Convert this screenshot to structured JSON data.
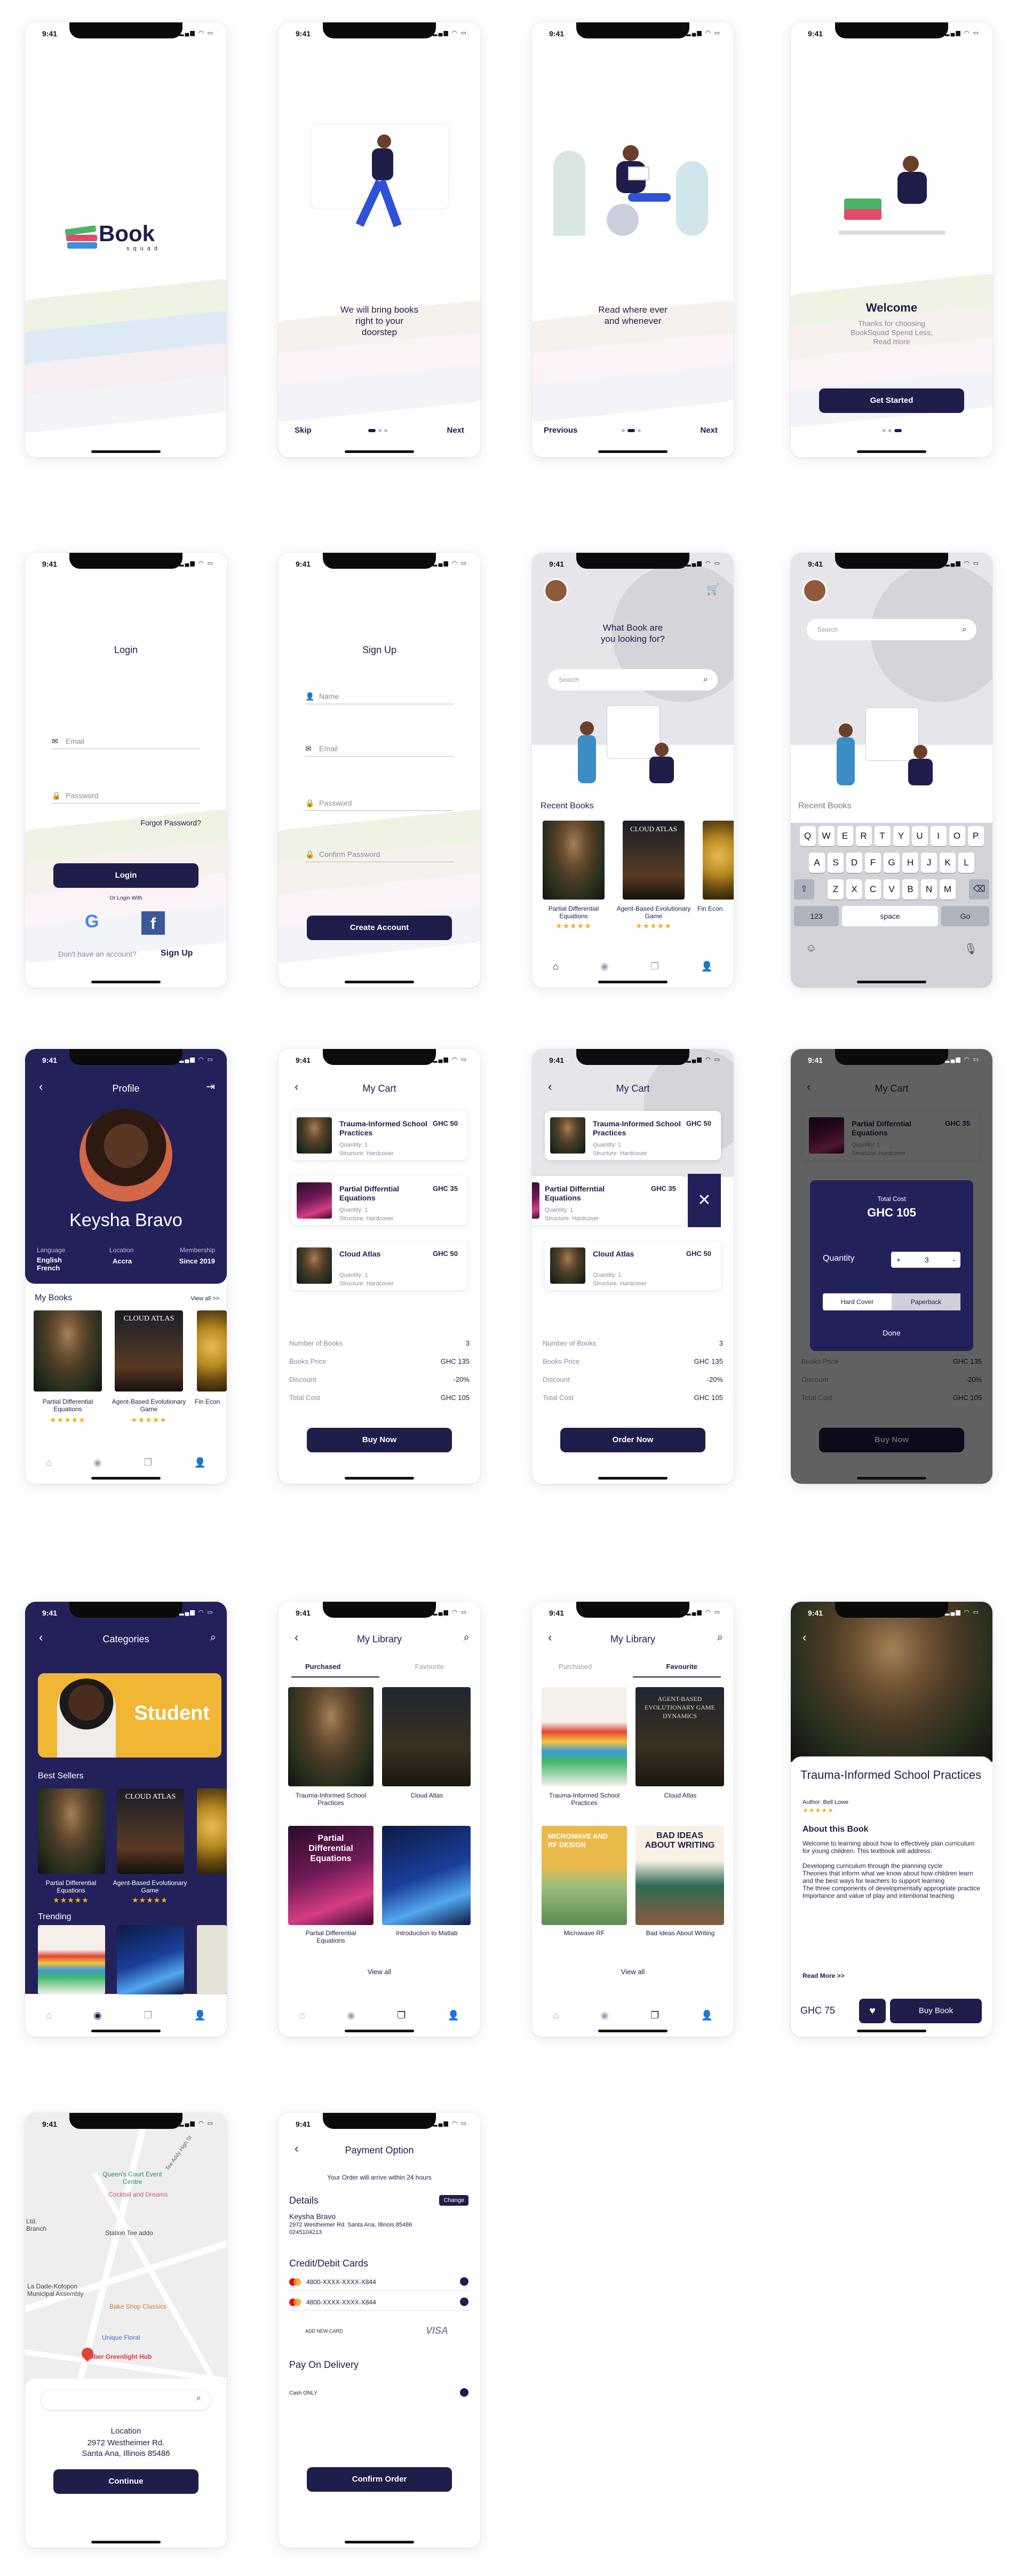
{
  "status_time": "9:41",
  "splash": {
    "logo_text": "Book",
    "logo_sub": "squad"
  },
  "onboard1": {
    "caption": "We will bring books right to your doorstep",
    "skip": "Skip",
    "next": "Next"
  },
  "onboard2": {
    "caption": "Read where ever and whenever",
    "previous": "Previous",
    "next": "Next"
  },
  "onboard3": {
    "title": "Welcome",
    "subtitle": "Thanks for choosing BookSquad Spend Less, Read more",
    "button": "Get Started"
  },
  "login": {
    "title": "Login",
    "email": "Email",
    "password": "Password",
    "forgot": "Forgot Password?",
    "button": "Login",
    "or": "Or Login With",
    "no_account": "Don't have an account?",
    "signup": "Sign Up"
  },
  "signup": {
    "title": "Sign Up",
    "name": "Name",
    "email": "Email",
    "password": "Password",
    "confirm": "Confirm Password",
    "button": "Create Account"
  },
  "home": {
    "question": "What Book are you looking for?",
    "search": "Search",
    "recent": "Recent Books"
  },
  "keyboard": {
    "search": "Search",
    "recent": "Recent Books",
    "row1": [
      "Q",
      "W",
      "E",
      "R",
      "T",
      "Y",
      "U",
      "I",
      "O",
      "P"
    ],
    "row2": [
      "A",
      "S",
      "D",
      "F",
      "G",
      "H",
      "J",
      "K",
      "L"
    ],
    "row3": [
      "Z",
      "X",
      "C",
      "V",
      "B",
      "N",
      "M"
    ],
    "num": "123",
    "space": "space",
    "go": "Go"
  },
  "books": {
    "partial": "Partial Differential Equations",
    "agent": "Agent-Based Evolutionary Game",
    "fin": "Fin Econ",
    "cloud_title": "CLOUD ATLAS",
    "trauma": "Trauma-Informed School Practices",
    "cloud": "Cloud Atlas",
    "intro": "Introduction to Matlab",
    "micro": "Microwave RF",
    "bad": "Bad Ideas About Writing",
    "partial_cover": "Partial Differential Equations",
    "agent_cover": "AGENT-BASED EVOLUTIONARY GAME DYNAMICS",
    "micro_cover": "MICROWAVE AND RF DESIGN",
    "bad_cover": "BAD IDEAS ABOUT WRITING",
    "stars": "★★★★★"
  },
  "profile": {
    "title": "Profile",
    "name": "Keysha Bravo",
    "lang_label": "Language",
    "lang": "English French",
    "loc_label": "Location",
    "loc": "Accra",
    "mem_label": "Membership",
    "mem": "Since 2019",
    "my_books": "My Books",
    "view_all": "View all >>"
  },
  "cart": {
    "title": "My Cart",
    "items": [
      {
        "title": "Trauma-Informed School Practices",
        "price": "GHC 50",
        "qty": "Quantity: 1",
        "struct": "Structure: Hardcover"
      },
      {
        "title": "Partial Differntial Equations",
        "price": "GHC 35",
        "qty": "Quantity: 1",
        "struct": "Structure: Hardcover"
      },
      {
        "title": "Cloud Atlas",
        "price": "GHC 50",
        "qty": "Quantity: 1",
        "struct": "Structure: Hardcover"
      }
    ],
    "num_label": "Number of Books",
    "num": "3",
    "price_label": "Books Price",
    "price": "GHC 135",
    "disc_label": "Discount",
    "disc": "-20%",
    "total_label": "Total Cost",
    "total": "GHC 105",
    "buy": "Buy Now",
    "order": "Order Now"
  },
  "modal": {
    "total_label": "Total Cost",
    "total": "GHC 105",
    "qty_label": "Quantity",
    "qty": "3",
    "minus": "-",
    "plus": "+",
    "hard": "Hard Cover",
    "paper": "Paperback",
    "done": "Done"
  },
  "categories": {
    "title": "Categories",
    "banner": "Student",
    "best": "Best Sellers",
    "trending": "Trending"
  },
  "library": {
    "title": "My Library",
    "purchased": "Purchased",
    "favourite": "Favourite",
    "view_all": "View all"
  },
  "detail": {
    "title": "Trauma-Informed School Practices",
    "author": "Author: Bell Lowe",
    "about": "About this Book",
    "desc": "Welcome to learning about how to effectively plan curriculum for young children. This textbook will address:",
    "p1": "Developing curriculum through the planning cycle",
    "p2": "Theories that inform what we know about how children learn and the best ways for teachers to support learning",
    "p3": "The three components of developmentally appropriate practice",
    "p4": "Importance and value of play and intentional teaching",
    "more": "Read More >>",
    "price": "GHC 75",
    "buy": "Buy Book"
  },
  "map": {
    "labels": [
      "Queen's Court Event Centre",
      "Cocktail and Dreams",
      "Tee Addy High St",
      "Station Tee addo",
      "La Dade-Kotopon Municipal Assembly",
      "Bake Shop Classics",
      "Unique Floral",
      "Uber Greenlight Hub",
      "Ltd. Branch"
    ],
    "loc_label": "Location",
    "addr1": "2972 Westheimer Rd.",
    "addr2": "Santa Ana, Illinois 85486",
    "button": "Continue"
  },
  "payment": {
    "title": "Payment Option",
    "arrival": "Your Order will arrive within 24 hours",
    "details": "Details",
    "change": "Change",
    "name": "Keysha Bravo",
    "addr": "2972 Westheimer Rd. Santa Ana, Illinois 85486",
    "phone": "0245104213",
    "cards_title": "Credit/Debit Cards",
    "card1": "4800-XXXX-XXXX-X844",
    "card2": "4800-XXXX-XXXX-X844",
    "add": "ADD NEW CARD",
    "visa": "VISA",
    "delivery": "Pay On Delivery",
    "cash": "Cash ONLY",
    "button": "Confirm Order"
  }
}
